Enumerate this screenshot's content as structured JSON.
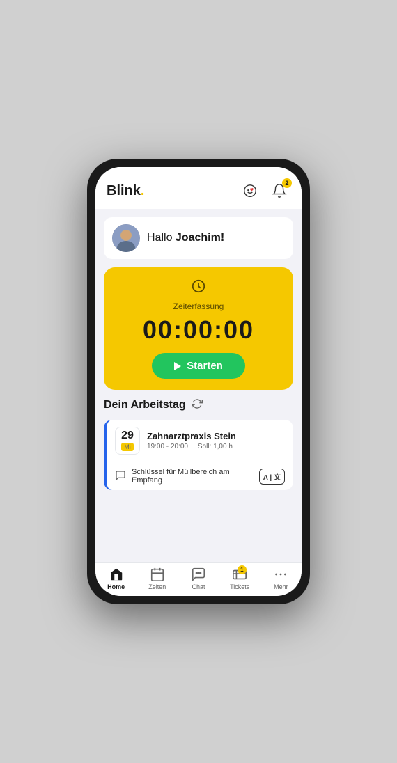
{
  "app": {
    "logo": "Blink",
    "logo_dot": "."
  },
  "header": {
    "smiley_icon": "smiley-heart-icon",
    "bell_icon": "bell-icon",
    "notification_count": "2"
  },
  "greeting": {
    "text_prefix": "Hallo ",
    "name": "Joachim!",
    "avatar_emoji": "🧑"
  },
  "timer": {
    "label": "Zeiterfassung",
    "display": "00:00:00",
    "start_label": "Starten"
  },
  "workday": {
    "section_title": "Dein Arbeitstag"
  },
  "shift": {
    "day": "29",
    "weekday": "Mi",
    "name": "Zahnarztpraxis Stein",
    "time": "19:00 - 20:00",
    "soll": "Soll: 1,00 h",
    "note": "Schlüssel für Müllbereich am Empfang",
    "translate_label": "A | 文"
  },
  "nav": {
    "items": [
      {
        "id": "home",
        "label": "Home",
        "active": true
      },
      {
        "id": "zeiten",
        "label": "Zeiten",
        "active": false
      },
      {
        "id": "chat",
        "label": "Chat",
        "active": false
      },
      {
        "id": "tickets",
        "label": "Tickets",
        "active": false,
        "badge": "1"
      },
      {
        "id": "mehr",
        "label": "Mehr",
        "active": false
      }
    ]
  }
}
